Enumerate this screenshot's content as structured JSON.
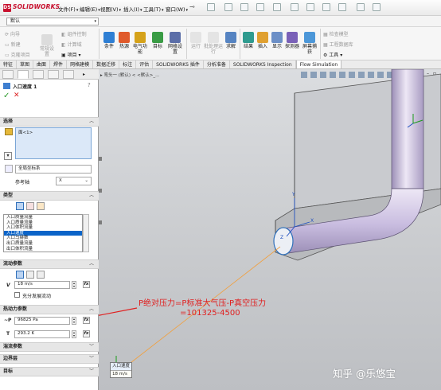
{
  "app": {
    "logo_text": "SOLIDWORKS",
    "logo_badge": "DS"
  },
  "menu": [
    {
      "label": "文件(F)"
    },
    {
      "label": "编辑(E)"
    },
    {
      "label": "视图(V)"
    },
    {
      "label": "插入(I)"
    },
    {
      "label": "工具(T)"
    },
    {
      "label": "窗口(W)"
    }
  ],
  "config_select": {
    "value": "默认"
  },
  "ribbon_left": [
    {
      "label": "向导"
    },
    {
      "label": "新建"
    },
    {
      "label": "克隆项目"
    },
    {
      "label": "常规设置"
    },
    {
      "label": "组件控制"
    },
    {
      "label": "计算域"
    },
    {
      "label": "项目"
    }
  ],
  "ribbon_buttons": [
    {
      "label": "条件"
    },
    {
      "label": "热源"
    },
    {
      "label": "电气功能"
    },
    {
      "label": "目标"
    },
    {
      "label": "网格设置"
    },
    {
      "label": "运行"
    },
    {
      "label": "批处理运行"
    },
    {
      "label": "求解"
    },
    {
      "label": "结果"
    },
    {
      "label": "插入"
    },
    {
      "label": "显示"
    },
    {
      "label": "探测器"
    },
    {
      "label": "屏幕捕获"
    }
  ],
  "ribbon_right": [
    {
      "label": "检查模型"
    },
    {
      "label": "工程数据库"
    },
    {
      "label": "工具"
    }
  ],
  "tabs": [
    {
      "label": "特征"
    },
    {
      "label": "草图"
    },
    {
      "label": "曲面"
    },
    {
      "label": "焊件"
    },
    {
      "label": "网格建模"
    },
    {
      "label": "数据迁移"
    },
    {
      "label": "标注"
    },
    {
      "label": "评估"
    },
    {
      "label": "SOLIDWORKS 插件"
    },
    {
      "label": "分析准备"
    },
    {
      "label": "SOLIDWORKS Inspection"
    },
    {
      "label": "Flow Simulation"
    }
  ],
  "panel": {
    "title": "入口速度 1",
    "ok": "✓",
    "cancel": "✕",
    "sections": {
      "selection": "选择",
      "type": "类型",
      "flow": "流动参数",
      "thermo": "热动力参数",
      "turbulence": "湍流参数",
      "boundary": "边界层",
      "target": "目标"
    },
    "selection_face": "面<1>",
    "coord_label": "全局坐标系",
    "ref_axis_label": "参考轴",
    "ref_axis_value": "X",
    "type_list": [
      {
        "label": "入口质量流量"
      },
      {
        "label": "入口质量流量"
      },
      {
        "label": "入口体积流量"
      },
      {
        "label": "入口速度"
      },
      {
        "label": "入口马赫数"
      },
      {
        "label": "出口质量流量"
      },
      {
        "label": "出口体积流量"
      }
    ],
    "type_selected_index": 3,
    "velocity_symbol": "V",
    "velocity_value": "18 m/s",
    "fully_developed": "充分发展流动",
    "pressure_symbol": "~P",
    "pressure_value": "96825 Pa",
    "temp_symbol": "T",
    "temp_value": "293.2 K",
    "fx": "fx"
  },
  "viewport": {
    "breadcrumb": "▸ 弯头一 (默认) < <默认>_...",
    "annotation_line1": "P绝对压力=P标准大气压-P真空压力",
    "annotation_line2": "=101325-4500",
    "callout_title": "入口速度",
    "callout_value": "18 m/s",
    "watermark": "知乎 @乐悠宝"
  },
  "colors": {
    "logo_red": "#c8102e",
    "selection_highlight": "#0a64c8",
    "list_blue": "#dbe8f8",
    "annotation_red": "#e02020",
    "pipe_purple": "#c9bde0"
  }
}
